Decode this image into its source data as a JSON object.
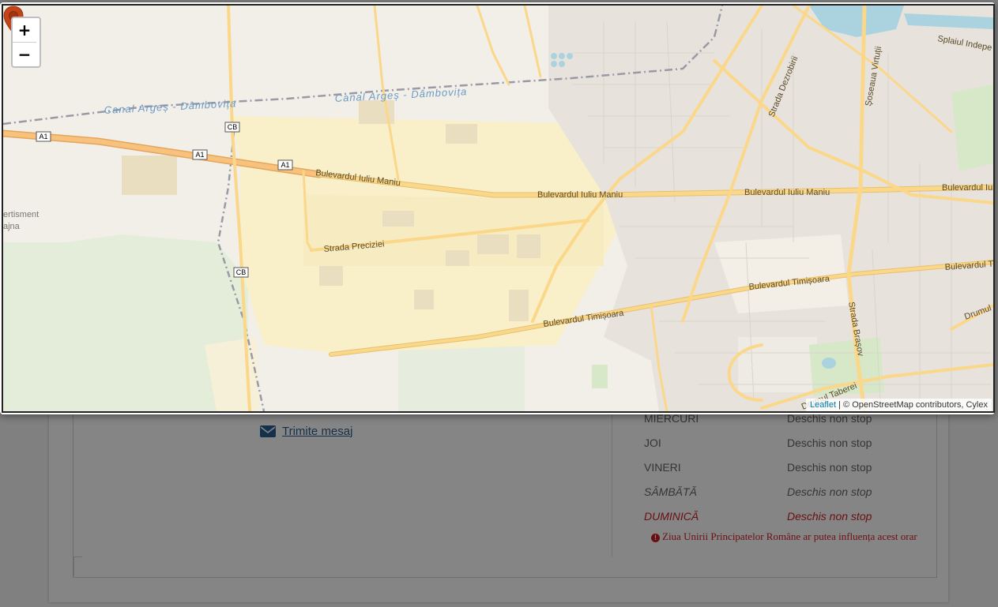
{
  "map": {
    "zoom_in_label": "+",
    "zoom_out_label": "−",
    "attribution": {
      "leaflet": "Leaflet",
      "separator": " | ",
      "text": "© OpenStreetMap contributors, Cylex"
    },
    "labels": {
      "canal_west": "Canal Argeș - Dâmbovița",
      "canal_east": "Canal Argeș - Dâmbovița",
      "iuliu_maniu_west": "Bulevardul Iuliu Maniu",
      "iuliu_maniu_mid": "Bulevardul Iuliu Maniu",
      "iuliu_maniu_east": "Bulevardul Iuliu Maniu",
      "iuliu_maniu_edge": "Bulevardul Iuliu",
      "preciziei": "Strada Preciziei",
      "timisoara_west": "Bulevardul Timișoara",
      "timisoara_east": "Bulevardul Timișoara",
      "timisoara_edge": "Bulevardul Ti",
      "dezrobirii": "Strada Dezrobirii",
      "virtutii": "Șoseaua Virtuții",
      "splaiul": "Splaiul Indepe",
      "brasov": "Strada Brașov",
      "drumul_taberei": "Drumul Taberei",
      "drumul_edge": "Drumul",
      "divertisment": "ertisment",
      "divertisment2": "ajna",
      "a1_1": "A1",
      "a1_2": "A1",
      "a1_3": "A1",
      "cb_1": "CB",
      "cb_2": "CB"
    },
    "colors": {
      "base": "#f2efe9",
      "industrial": "#f9efc9",
      "park": "#e2ecd7",
      "road_main": "#fbd78a",
      "highway": "#f4b86a",
      "water": "#aad3df",
      "marker": "#c1441b"
    }
  },
  "background": {
    "contact": {
      "icon": "envelope-icon",
      "link_text": "Trimite mesaj"
    },
    "schedule": [
      {
        "day": "MIERCURI",
        "hours": "Deschis non stop",
        "type": "normal"
      },
      {
        "day": "JOI",
        "hours": "Deschis non stop",
        "type": "normal"
      },
      {
        "day": "VINERI",
        "hours": "Deschis non stop",
        "type": "normal"
      },
      {
        "day": "SÂMBĂTĂ",
        "hours": "Deschis non stop",
        "type": "weekend"
      },
      {
        "day": "DUMINICĂ",
        "hours": "Deschis non stop",
        "type": "holiday"
      }
    ],
    "holiday_note": "Ziua Unirii Principatelor Române ar putea influența acest orar"
  }
}
